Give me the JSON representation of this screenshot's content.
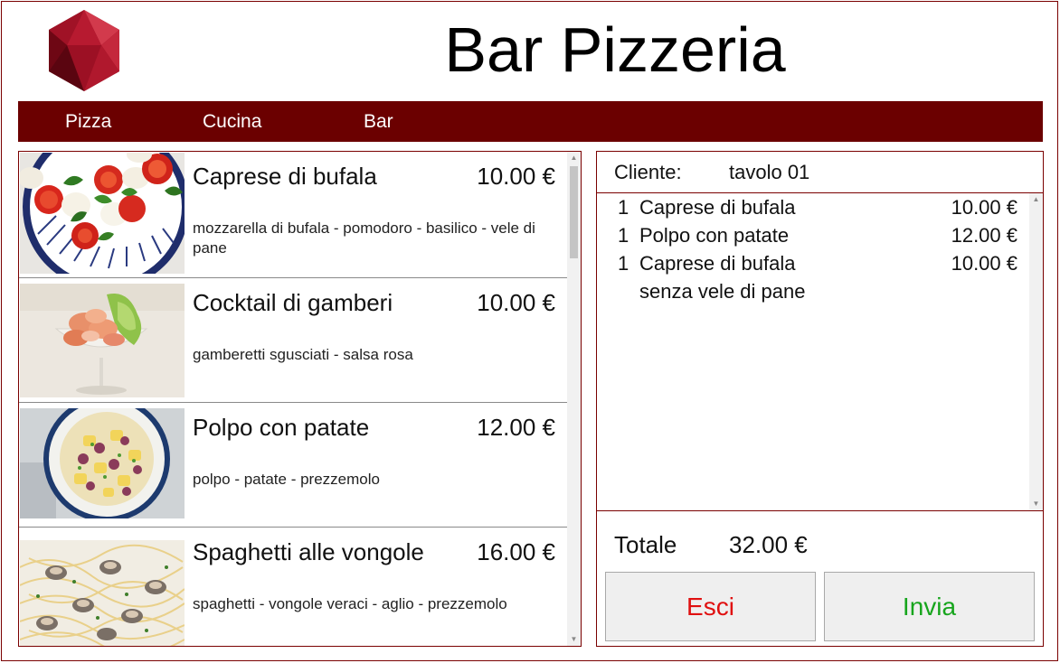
{
  "header": {
    "title": "Bar Pizzeria",
    "logo_icon": "red-hexagon-gem-logo"
  },
  "nav": {
    "items": [
      {
        "label": "Pizza"
      },
      {
        "label": "Cucina"
      },
      {
        "label": "Bar"
      }
    ]
  },
  "menu": {
    "items": [
      {
        "name": "Caprese di bufala",
        "price": "10.00 €",
        "description": "mozzarella di bufala - pomodoro - basilico - vele di pane",
        "image": "caprese-salad-photo"
      },
      {
        "name": "Cocktail di gamberi",
        "price": "10.00 €",
        "description": "gamberetti sgusciati - salsa rosa",
        "image": "shrimp-cocktail-photo"
      },
      {
        "name": "Polpo con patate",
        "price": "12.00 €",
        "description": "polpo - patate - prezzemolo",
        "image": "octopus-potato-salad-photo"
      },
      {
        "name": "Spaghetti alle vongole",
        "price": "16.00 €",
        "description": "spaghetti - vongole veraci - aglio - prezzemolo",
        "image": "spaghetti-clams-photo"
      }
    ]
  },
  "order": {
    "client_label": "Cliente:",
    "client_value": "tavolo 01",
    "lines": [
      {
        "qty": "1",
        "name": "Caprese di bufala",
        "price": "10.00 €",
        "note": ""
      },
      {
        "qty": "1",
        "name": "Polpo con patate",
        "price": "12.00 €",
        "note": ""
      },
      {
        "qty": "1",
        "name": "Caprese di bufala",
        "price": "10.00 €",
        "note": "senza vele di pane"
      }
    ],
    "total_label": "Totale",
    "total_value": "32.00 €"
  },
  "actions": {
    "exit_label": "Esci",
    "send_label": "Invia"
  },
  "colors": {
    "brand": "#6b0000",
    "exit": "#e01010",
    "send": "#17a51d"
  }
}
